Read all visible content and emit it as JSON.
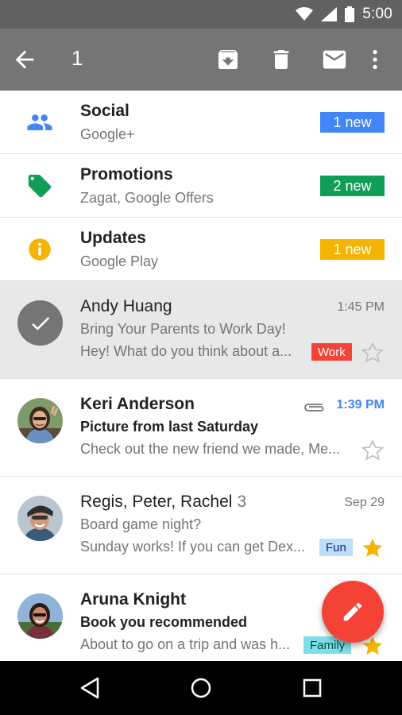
{
  "status_bar": {
    "time": "5:00",
    "icons": [
      "wifi-icon",
      "cellular-icon",
      "battery-icon"
    ]
  },
  "action_bar": {
    "selected_count": "1",
    "icons": [
      "back-arrow-icon",
      "archive-icon",
      "delete-icon",
      "mark-unread-icon",
      "overflow-menu-icon"
    ],
    "background": "#757575"
  },
  "categories": [
    {
      "title": "Social",
      "subtitle": "Google+",
      "badge": "1 new",
      "color": "#4285f4",
      "icon": "people-icon"
    },
    {
      "title": "Promotions",
      "subtitle": "Zagat, Google Offers",
      "badge": "2 new",
      "color": "#0f9d58",
      "icon": "tag-icon"
    },
    {
      "title": "Updates",
      "subtitle": "Google Play",
      "badge": "1 new",
      "color": "#f4b400",
      "icon": "info-icon"
    }
  ],
  "emails": [
    {
      "sender": "Andy Huang",
      "time": "1:45 PM",
      "subject": "Bring Your Parents to Work Day!",
      "snippet": "Hey! What do you think about a...",
      "label": "Work",
      "label_color": "#f44336",
      "starred": false,
      "selected": true,
      "unread": false
    },
    {
      "sender": "Keri Anderson",
      "time": "1:39 PM",
      "subject": "Picture from last Saturday",
      "snippet": "Check out the new friend we made, Me...",
      "starred": false,
      "unread": true,
      "has_attachment": true
    },
    {
      "sender": "Regis, Peter, Rachel",
      "count": "3",
      "time": "Sep 29",
      "subject": "Board game night?",
      "snippet": "Sunday works! If you can get Dex...",
      "label": "Fun",
      "label_color": "#bbdefb",
      "starred": true,
      "unread": false
    },
    {
      "sender": "Aruna Knight",
      "subject": "Book you recommended",
      "snippet": "About to go on a trip and was h...",
      "label": "Family",
      "label_color": "#80deea",
      "starred": true,
      "unread": true
    }
  ],
  "fab": {
    "icon": "pencil-icon",
    "color": "#f44336"
  },
  "nav_bar": {
    "icons": [
      "back-triangle-icon",
      "home-circle-icon",
      "recents-square-icon"
    ]
  }
}
